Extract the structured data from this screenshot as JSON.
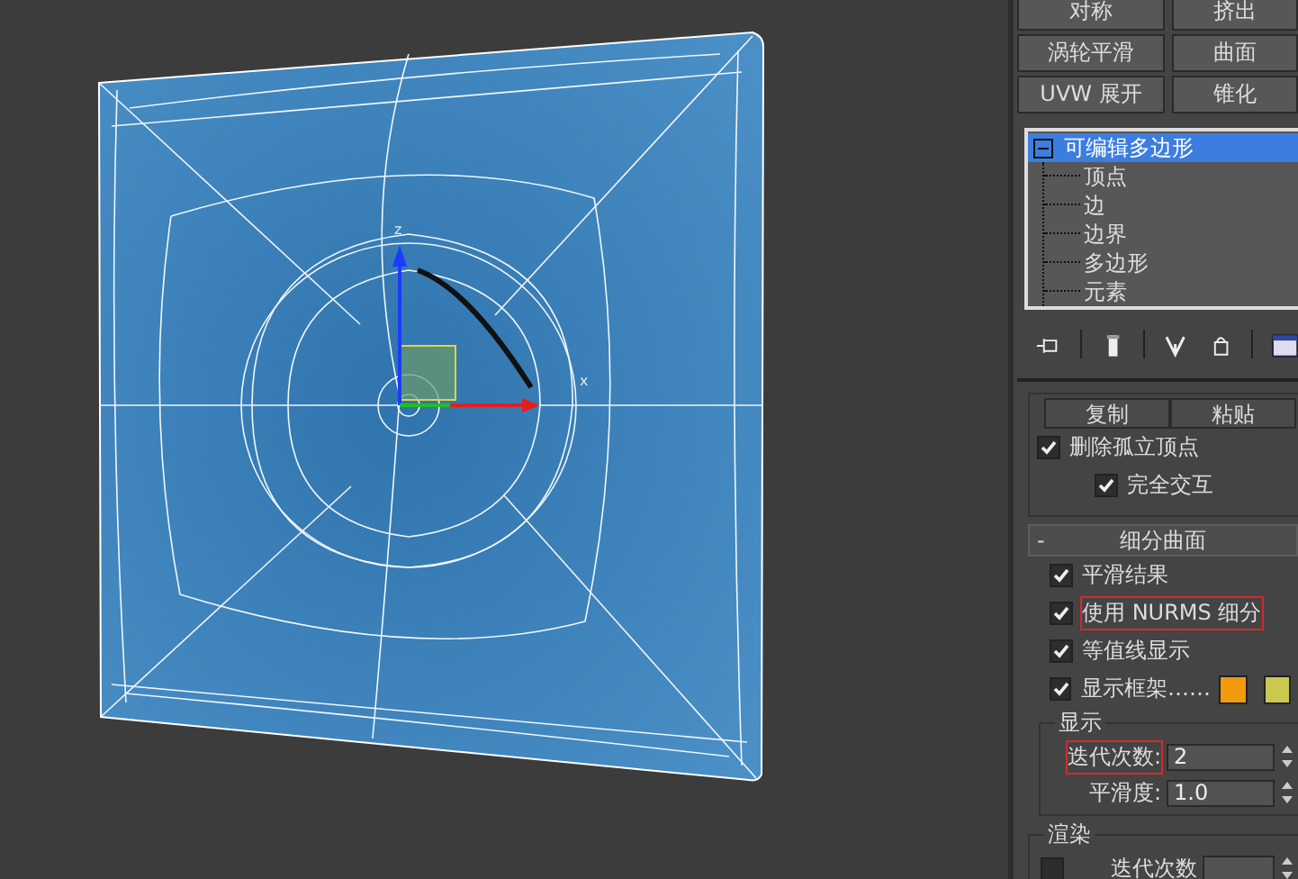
{
  "viewport": {
    "axis_labels": [
      {
        "label": "z"
      },
      {
        "label": "x"
      }
    ]
  },
  "modifier_buttons": [
    {
      "label": "对称"
    },
    {
      "label": "挤出"
    },
    {
      "label": "涡轮平滑"
    },
    {
      "label": "曲面"
    },
    {
      "label": "UVW 展开"
    },
    {
      "label": "锥化"
    }
  ],
  "modifier_stack": {
    "items": [
      {
        "label": "可编辑多边形",
        "selected": true,
        "expanded": true,
        "children": [
          {
            "label": "顶点",
            "selected": false
          },
          {
            "label": "边",
            "selected": false
          },
          {
            "label": "边界",
            "selected": false
          },
          {
            "label": "多边形",
            "selected": false
          },
          {
            "label": "元素",
            "selected": false
          }
        ]
      }
    ]
  },
  "selection_rollout": {
    "buttons": [
      {
        "label": "复制"
      },
      {
        "label": "粘贴"
      }
    ],
    "checkboxes": [
      {
        "label": "删除孤立顶点",
        "checked": true,
        "kind": "main"
      },
      {
        "label": "完全交互",
        "checked": true,
        "kind": "sub"
      }
    ]
  },
  "subdivision_rollout": {
    "toggle": "-",
    "title": "细分曲面",
    "checkboxes": [
      {
        "label": "平滑结果",
        "checked": true,
        "highlighted": false
      },
      {
        "label": "使用 NURMS 细分",
        "checked": true,
        "highlighted": true
      },
      {
        "label": "等值线显示",
        "checked": true,
        "highlighted": false
      },
      {
        "label": "显示框架……",
        "checked": true,
        "highlighted": false,
        "swatches": [
          {
            "color": "#f09a0c"
          },
          {
            "color": "#c9c94e"
          }
        ]
      }
    ],
    "display_group": {
      "title": "显示",
      "fields": [
        {
          "label": "迭代次数:",
          "value": "2",
          "highlighted": true
        },
        {
          "label": "平滑度:",
          "value": "1.0",
          "highlighted": false
        }
      ]
    },
    "render_group": {
      "title": "渲染",
      "rows": [
        {
          "label": "迭代次数",
          "checked": false
        }
      ]
    }
  }
}
